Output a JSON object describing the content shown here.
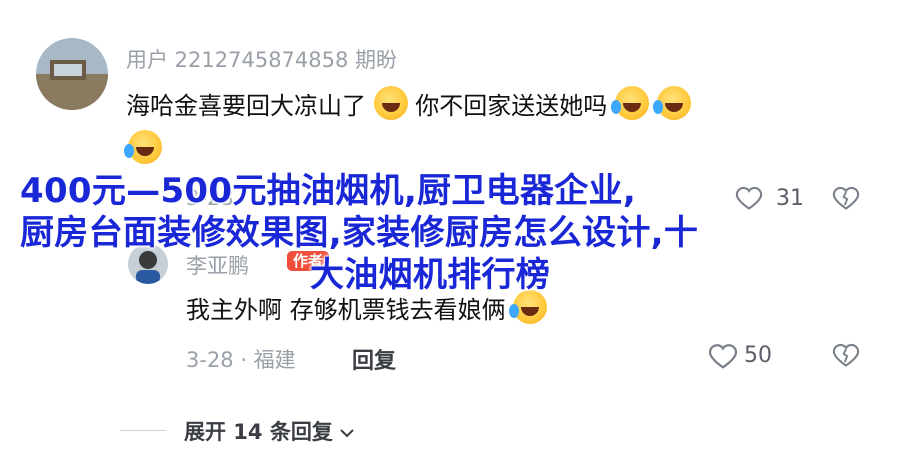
{
  "comment": {
    "username": "用户 2212745874858 期盼",
    "text": "海哈金喜要回大凉山了",
    "text2": "你不回家送送她吗"
  },
  "reply": {
    "author": "李亚鹏",
    "badge": "作者",
    "text": "我主外啊 存够机票钱去看娘俩",
    "date_location": "3-28 · 福建",
    "reply_label": "回复",
    "likes": "50"
  },
  "hidden_meta": {
    "date_fragment": "3-28",
    "likes": "31"
  },
  "overlay": {
    "line1": "400元—500元抽油烟机,厨卫电器企业,",
    "line2": "厨房台面装修效果图,家装修厨房怎么设计,十",
    "line3": "大油烟机排行榜"
  },
  "expand": {
    "label": "展开 14 条回复"
  },
  "colors": {
    "overlay_text": "#1a27d6",
    "badge": "#f04d3a",
    "meta": "#9aa0a8"
  }
}
